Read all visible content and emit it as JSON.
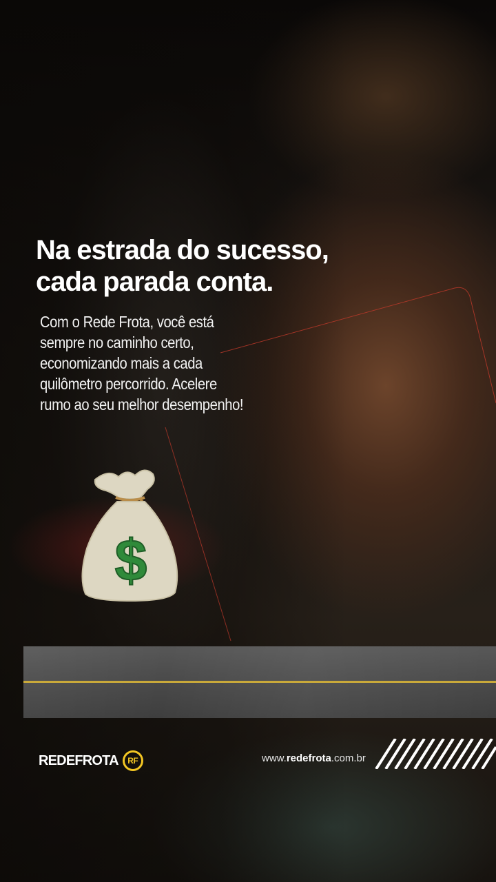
{
  "headline": {
    "line1": "Na estrada do sucesso,",
    "line2": "cada parada conta."
  },
  "body": {
    "line1": "Com o Rede Frota, você está",
    "line2": "sempre no caminho certo,",
    "line3": "economizando mais a cada",
    "line4": "quilômetro percorrido. Acelere",
    "line5": "rumo ao seu melhor desempenho!"
  },
  "illustration": {
    "icon": "money-bag-icon",
    "symbol": "$"
  },
  "footer": {
    "logo_text": "REDEFROTA",
    "logo_badge": "RF",
    "website_prefix": "www.",
    "website_brand": "redefrota",
    "website_suffix": ".com.br"
  },
  "colors": {
    "accent_yellow": "#f3c623",
    "band_gray": "#4a4a4a",
    "stripe_gold": "#c9a93a",
    "dollar_green": "#2f8a3a",
    "bag_beige": "#ddd7c2"
  }
}
